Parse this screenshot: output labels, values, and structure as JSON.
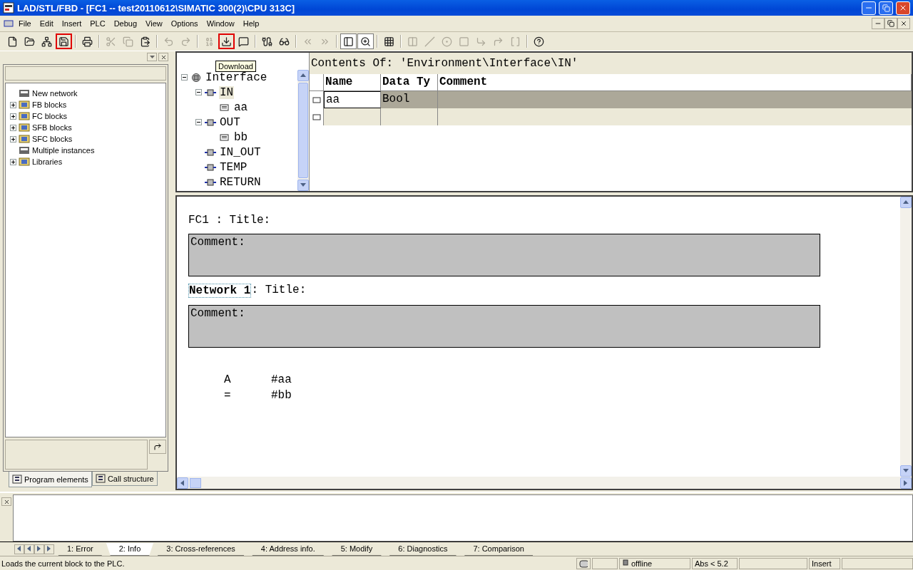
{
  "window": {
    "title": "LAD/STL/FBD  - [FC1 -- test20110612\\SIMATIC 300(2)\\CPU 313C]"
  },
  "menu": [
    "File",
    "Edit",
    "Insert",
    "PLC",
    "Debug",
    "View",
    "Options",
    "Window",
    "Help"
  ],
  "toolbar": [
    {
      "kind": "button",
      "highlighted": false,
      "disabled": false,
      "pressed": false
    },
    {
      "kind": "button",
      "highlighted": false,
      "disabled": false,
      "pressed": false
    },
    {
      "kind": "button",
      "highlighted": false,
      "disabled": false,
      "pressed": false
    },
    {
      "kind": "button",
      "highlighted": true,
      "disabled": false,
      "pressed": false
    },
    {
      "kind": "separator"
    },
    {
      "kind": "button",
      "highlighted": false,
      "disabled": false,
      "pressed": false
    },
    {
      "kind": "separator"
    },
    {
      "kind": "button",
      "highlighted": false,
      "disabled": true,
      "pressed": false
    },
    {
      "kind": "button",
      "highlighted": false,
      "disabled": true,
      "pressed": false
    },
    {
      "kind": "button",
      "highlighted": false,
      "disabled": false,
      "pressed": false
    },
    {
      "kind": "separator"
    },
    {
      "kind": "button",
      "highlighted": false,
      "disabled": true,
      "pressed": false
    },
    {
      "kind": "button",
      "highlighted": false,
      "disabled": true,
      "pressed": false
    },
    {
      "kind": "separator"
    },
    {
      "kind": "button",
      "highlighted": false,
      "disabled": true,
      "pressed": false
    },
    {
      "kind": "button",
      "highlighted": true,
      "disabled": false,
      "pressed": false
    },
    {
      "kind": "button",
      "highlighted": false,
      "disabled": false,
      "pressed": false
    },
    {
      "kind": "separator"
    },
    {
      "kind": "button",
      "highlighted": false,
      "disabled": false,
      "pressed": false
    },
    {
      "kind": "button",
      "highlighted": false,
      "disabled": false,
      "pressed": false
    },
    {
      "kind": "separator"
    },
    {
      "kind": "button",
      "highlighted": false,
      "disabled": true,
      "pressed": false
    },
    {
      "kind": "button",
      "highlighted": false,
      "disabled": true,
      "pressed": false
    },
    {
      "kind": "separator"
    },
    {
      "kind": "button",
      "highlighted": false,
      "disabled": false,
      "pressed": true
    },
    {
      "kind": "button",
      "highlighted": false,
      "disabled": false,
      "pressed": true
    },
    {
      "kind": "separator"
    },
    {
      "kind": "button",
      "highlighted": false,
      "disabled": false,
      "pressed": false
    },
    {
      "kind": "separator"
    },
    {
      "kind": "button",
      "highlighted": false,
      "disabled": true,
      "pressed": false
    },
    {
      "kind": "button",
      "highlighted": false,
      "disabled": true,
      "pressed": false
    },
    {
      "kind": "button",
      "highlighted": false,
      "disabled": true,
      "pressed": false
    },
    {
      "kind": "button",
      "highlighted": false,
      "disabled": true,
      "pressed": false
    },
    {
      "kind": "button",
      "highlighted": false,
      "disabled": true,
      "pressed": false
    },
    {
      "kind": "button",
      "highlighted": false,
      "disabled": true,
      "pressed": false
    },
    {
      "kind": "button",
      "highlighted": false,
      "disabled": true,
      "pressed": false
    },
    {
      "kind": "separator"
    },
    {
      "kind": "button",
      "highlighted": false,
      "disabled": false,
      "pressed": false
    }
  ],
  "tooltip": "Download",
  "program_elements": [
    {
      "label": "New network",
      "kind": "leaf"
    },
    {
      "label": "FB blocks",
      "kind": "folder"
    },
    {
      "label": "FC blocks",
      "kind": "folder"
    },
    {
      "label": "SFB blocks",
      "kind": "folder"
    },
    {
      "label": "SFC blocks",
      "kind": "folder"
    },
    {
      "label": "Multiple instances",
      "kind": "leaf"
    },
    {
      "label": "Libraries",
      "kind": "folder"
    }
  ],
  "left_tabs": [
    {
      "label": "Program elements",
      "selected": true
    },
    {
      "label": "Call structure",
      "selected": false
    }
  ],
  "interface_tree": [
    {
      "label": "Interface",
      "expanded": true,
      "selected": false,
      "children": [
        {
          "label": "IN",
          "expanded": true,
          "selected": true,
          "children": [
            {
              "label": "aa",
              "selected": false
            }
          ]
        },
        {
          "label": "OUT",
          "expanded": true,
          "selected": false,
          "children": [
            {
              "label": "bb",
              "selected": false
            }
          ]
        },
        {
          "label": "IN_OUT",
          "selected": false
        },
        {
          "label": "TEMP",
          "selected": false
        },
        {
          "label": "RETURN",
          "selected": false
        }
      ]
    }
  ],
  "contents": {
    "title": "Contents Of: 'Environment\\Interface\\IN'",
    "columns": [
      "Name",
      "Data Ty",
      "Comment"
    ],
    "rows": [
      {
        "name": "aa",
        "data_type": "Bool",
        "selected": true
      },
      {
        "selected": false
      }
    ]
  },
  "editor": {
    "block_title": "FC1 : Title:",
    "block_comment": "Comment:",
    "network_label": "Network 1",
    "network_title": ": Title:",
    "network_comment": "Comment:",
    "code": [
      {
        "op": "A",
        "operand": "#aa"
      },
      {
        "op": "=",
        "operand": "#bb"
      }
    ]
  },
  "output_tabs": [
    {
      "label": "1: Error",
      "selected": false
    },
    {
      "label": "2: Info",
      "selected": true
    },
    {
      "label": "3: Cross-references",
      "selected": false
    },
    {
      "label": "4: Address info.",
      "selected": false
    },
    {
      "label": "5: Modify",
      "selected": false
    },
    {
      "label": "6: Diagnostics",
      "selected": false
    },
    {
      "label": "7: Comparison",
      "selected": false
    }
  ],
  "status_bar": {
    "message": "Loads the current block to the PLC.",
    "connection": "offline",
    "version": "Abs < 5.2",
    "mode": "Insert"
  }
}
